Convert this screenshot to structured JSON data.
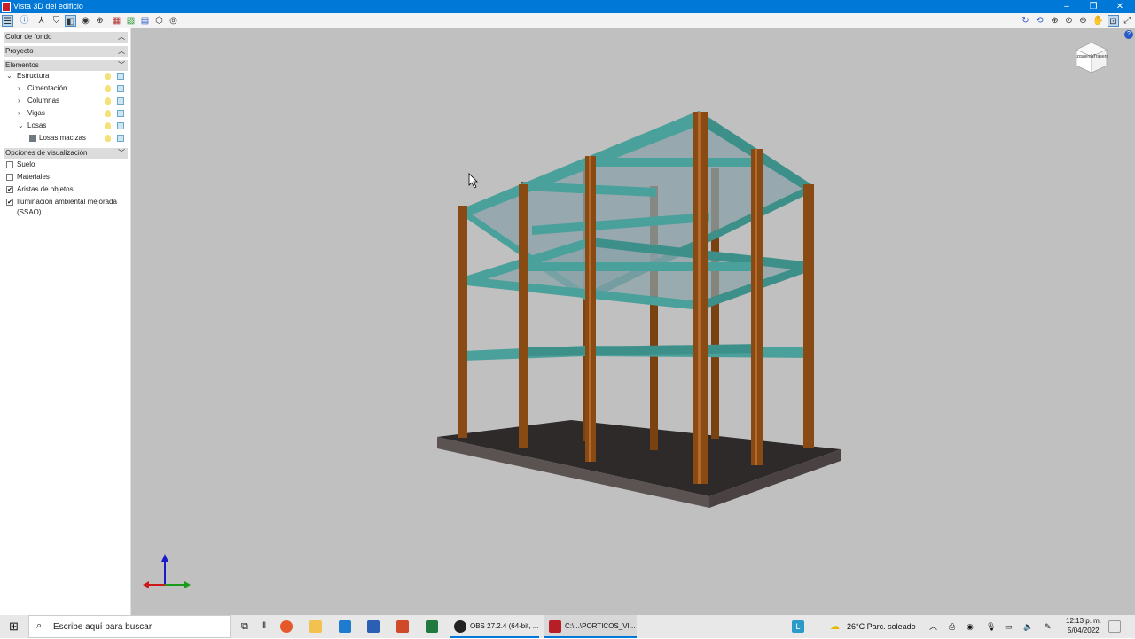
{
  "window": {
    "title": "Vista 3D del edificio"
  },
  "sidebar": {
    "panels": {
      "background": "Color de fondo",
      "project": "Proyecto",
      "elements": "Elementos",
      "display": "Opciones de visualización"
    },
    "tree": {
      "structure": "Estructura",
      "foundation": "Cimentación",
      "columns": "Columnas",
      "beams": "Vigas",
      "slabs": "Losas",
      "solid_slabs": "Losas macizas"
    },
    "options": {
      "floor": {
        "label": "Suelo",
        "checked": false
      },
      "materials": {
        "label": "Materiales",
        "checked": false
      },
      "edges": {
        "label": "Aristas de objetos",
        "checked": true
      },
      "ssao": {
        "label": "Iluminación ambiental mejorada (SSAO)",
        "checked": true
      }
    }
  },
  "viewcube": {
    "left_label": "Izquierda",
    "right_label": "Trasera"
  },
  "taskbar": {
    "search_placeholder": "Escribe aquí para buscar",
    "obs_label": "OBS 27.2.4 (64-bit, ...",
    "app_label": "C:\\...\\PORTICOS_VI...",
    "weather": "26°C  Parc. soleado",
    "time": "12:13 p. m.",
    "date": "5/04/2022"
  },
  "colors": {
    "titlebar": "#0078d7",
    "viewport_bg": "#c0c0c0",
    "column": "#8a4a14",
    "beam": "#4a9c93",
    "slab": "#7a9aa4",
    "foundation": "#3a3434"
  }
}
